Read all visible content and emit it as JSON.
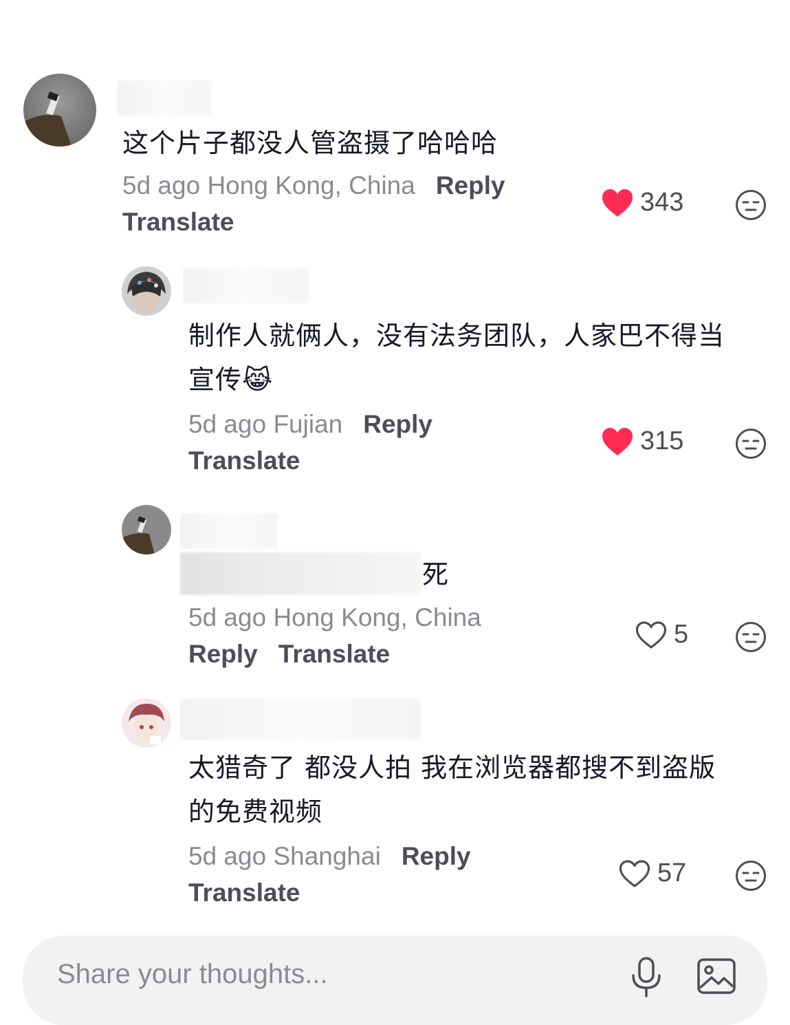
{
  "comments": [
    {
      "text": "这个片子都没人管盗摄了哈哈哈",
      "meta": "5d ago Hong Kong, China",
      "reply_label": "Reply",
      "translate_label": "Translate",
      "likes": "343",
      "liked": true
    },
    {
      "text_line1": "制作人就俩人，没有法务团队，人家巴不得当",
      "text_line2": "宣传",
      "emoji": "😹",
      "meta": "5d ago Fujian",
      "reply_label": "Reply",
      "translate_label": "Translate",
      "likes": "315",
      "liked": true
    },
    {
      "text_visible": "死",
      "meta": "5d ago Hong Kong, China",
      "reply_label": "Reply",
      "translate_label": "Translate",
      "likes": "5",
      "liked": false
    },
    {
      "text_line1": "太猎奇了 都没人拍 我在浏览器都搜不到盗版",
      "text_line2": "的免费视频",
      "meta": "5d ago Shanghai",
      "reply_label": "Reply",
      "translate_label": "Translate",
      "likes": "57",
      "liked": false
    }
  ],
  "input": {
    "placeholder": "Share your thoughts..."
  },
  "colors": {
    "like_red": "#fe2c55",
    "meta_gray": "#8a8b91",
    "action_gray": "#4d4e55",
    "input_bg": "#f2f2f3"
  }
}
